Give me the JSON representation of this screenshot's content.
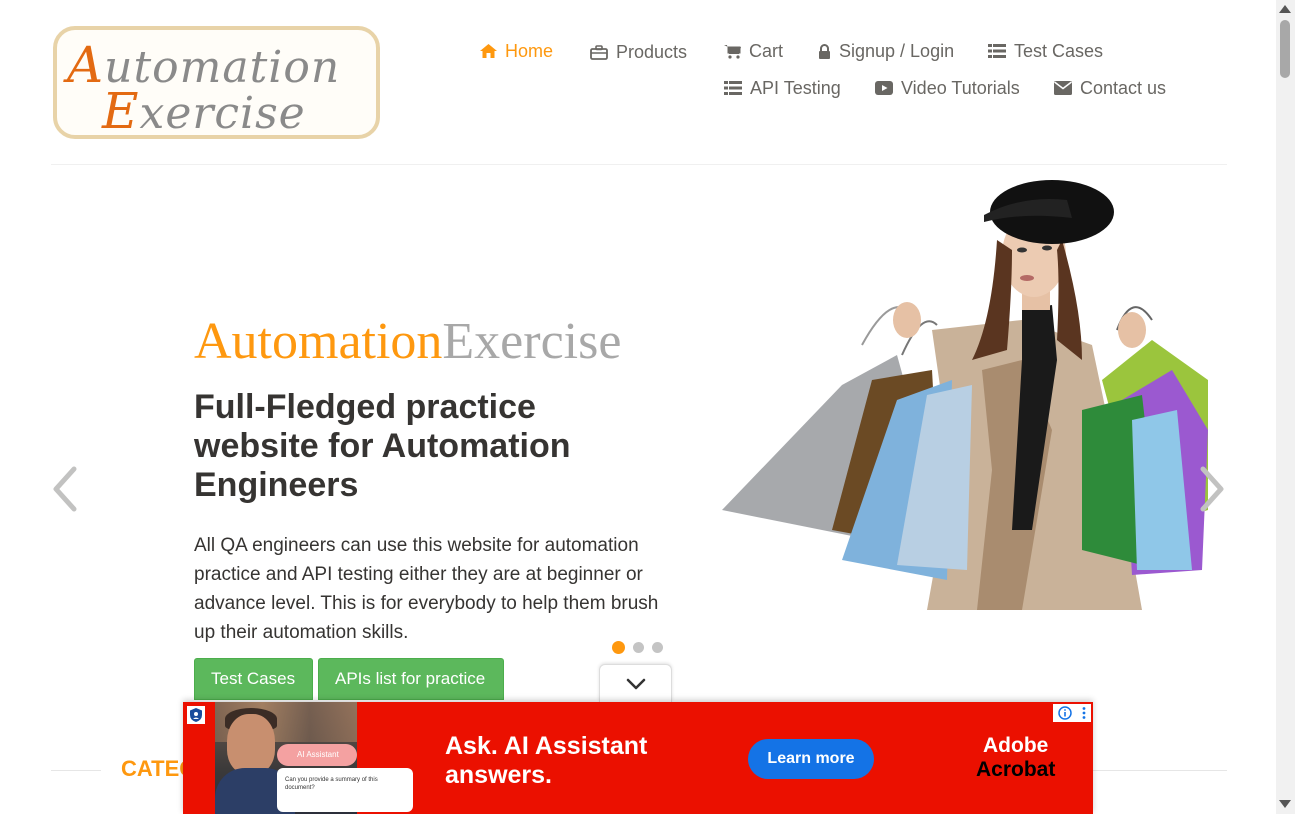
{
  "logo": {
    "line1": "Automation",
    "line2": "Exercise"
  },
  "nav": {
    "home": "Home",
    "products": "Products",
    "cart": "Cart",
    "signup_login": "Signup / Login",
    "test_cases": "Test Cases",
    "api_testing": "API Testing",
    "video_tutorials": "Video Tutorials",
    "contact_us": "Contact us",
    "active_color": "#fe980f",
    "text_color": "#696763"
  },
  "slider": {
    "title_part1": "Automation",
    "title_part2": "Exercise",
    "headline": "Full-Fledged practice website for Automation Engineers",
    "description": "All QA engineers can use this website for automation practice and API testing either they are at beginner or advance level. This is for everybody to help them brush up their automation skills.",
    "button_test_cases": "Test Cases",
    "button_apis": "APIs list for practice",
    "active_slide": 1,
    "slide_count": 3,
    "accent_color": "#fe980f",
    "button_color": "#5cb85c"
  },
  "category": {
    "title_visible": "CATEG"
  },
  "ad": {
    "bubble": "AI Assistant",
    "card_text": "Can you provide a summary of this document?",
    "headline_line1": "Ask. AI Assistant",
    "headline_line2": "answers.",
    "cta": "Learn more",
    "brand_line1": "Adobe",
    "brand_line2": "Acrobat",
    "background_color": "#eb1000",
    "cta_color": "#1473e6"
  }
}
